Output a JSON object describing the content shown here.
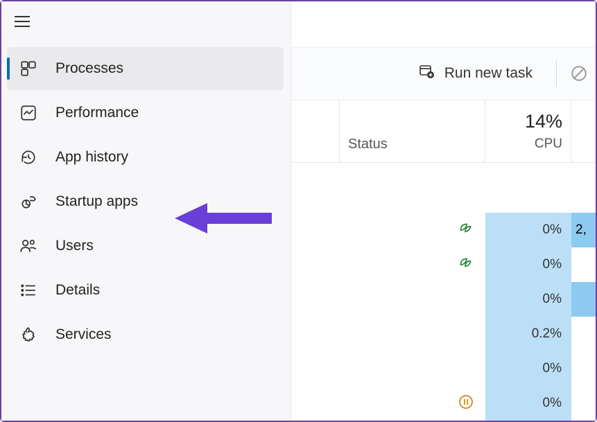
{
  "sidebar": {
    "items": [
      {
        "label": "Processes"
      },
      {
        "label": "Performance"
      },
      {
        "label": "App history"
      },
      {
        "label": "Startup apps"
      },
      {
        "label": "Users"
      },
      {
        "label": "Details"
      },
      {
        "label": "Services"
      }
    ]
  },
  "toolbar": {
    "run_new_task": "Run new task"
  },
  "table": {
    "headers": {
      "status": "Status",
      "cpu_label": "CPU",
      "cpu_pct": "14%"
    },
    "rows": [
      {
        "status": "",
        "cpu": "",
        "mem": ""
      },
      {
        "status": "leaf",
        "cpu": "0%",
        "mem": "2,"
      },
      {
        "status": "leaf",
        "cpu": "0%",
        "mem": ""
      },
      {
        "status": "",
        "cpu": "0%",
        "mem": ""
      },
      {
        "status": "",
        "cpu": "0.2%",
        "mem": ""
      },
      {
        "status": "",
        "cpu": "0%",
        "mem": ""
      },
      {
        "status": "pause",
        "cpu": "0%",
        "mem": ""
      }
    ]
  }
}
